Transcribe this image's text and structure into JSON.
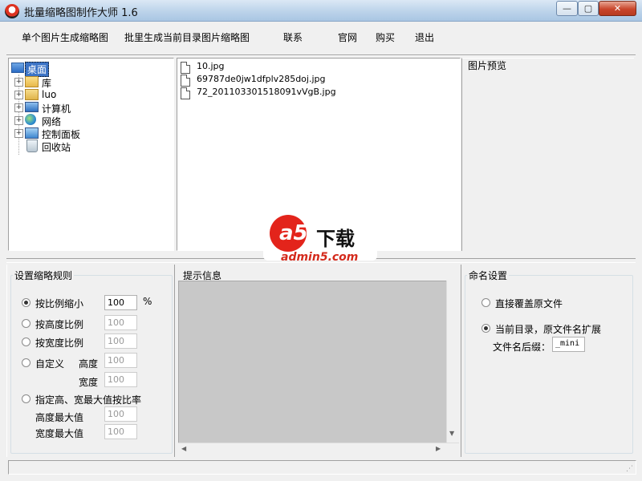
{
  "window": {
    "title": "批量缩略图制作大师 1.6",
    "controls": {
      "minimize": "—",
      "maximize": "▢",
      "close": "✕"
    }
  },
  "menu": [
    "单个图片生成缩略图",
    "批里生成当前目录图片缩略图",
    "联系",
    "官网",
    "购买",
    "退出"
  ],
  "tree": {
    "root": "桌面",
    "items": [
      "库",
      "luo",
      "计算机",
      "网络",
      "控制面板",
      "回收站"
    ]
  },
  "files": [
    "10.jpg",
    "69787de0jw1dfplv285doj.jpg",
    "72_2011033015180​91vVgB.jpg"
  ],
  "preview": {
    "title": "图片预览"
  },
  "rules": {
    "title": "设置缩略规则",
    "ratio_label": "按比例缩小",
    "ratio_value": "100",
    "percent": "%",
    "height_ratio_label": "按高度比例",
    "height_ratio_value": "100",
    "width_ratio_label": "按宽度比例",
    "width_ratio_value": "100",
    "custom_label": "自定义",
    "custom_height_label": "高度",
    "custom_height_value": "100",
    "custom_width_label": "宽度",
    "custom_width_value": "100",
    "max_label": "指定高、宽最大值按比率",
    "max_height_label": "高度最大值",
    "max_height_value": "100",
    "max_width_label": "宽度最大值",
    "max_width_value": "100"
  },
  "info": {
    "title": "提示信息"
  },
  "naming": {
    "title": "命名设置",
    "overwrite_label": "直接覆盖原文件",
    "extend_label": "当前目录，原文件名扩展",
    "suffix_label": "文件名后缀：",
    "suffix_value": "_mini"
  },
  "watermark": {
    "a5": "a5",
    "text": "下载",
    "sub": "admin5.com"
  }
}
